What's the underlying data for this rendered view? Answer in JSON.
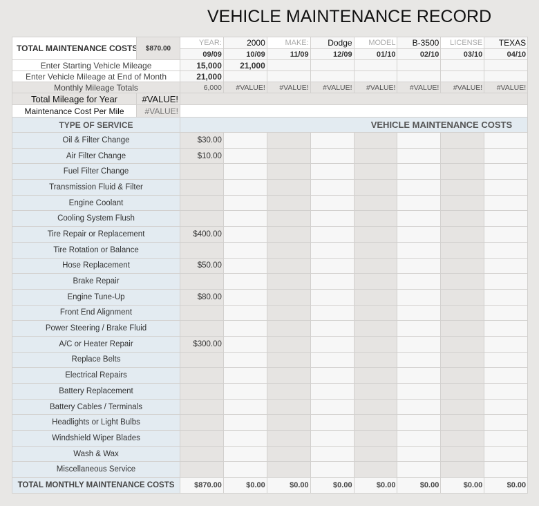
{
  "title": "VEHICLE MAINTENANCE RECORD",
  "header": {
    "total_label": "TOTAL MAINTENANCE COSTS",
    "total_value": "$870.00",
    "vehicle": [
      {
        "label": "YEAR:",
        "value": "2000"
      },
      {
        "label": "MAKE:",
        "value": "Dodge"
      },
      {
        "label": "MODEL",
        "value": "B-3500"
      },
      {
        "label": "LICENSE",
        "value": "TEXAS"
      }
    ],
    "months": [
      "09/09",
      "10/09",
      "11/09",
      "12/09",
      "01/10",
      "02/10",
      "03/10",
      "04/10"
    ]
  },
  "mileage": {
    "start_label": "Enter Starting Vehicle Mileage",
    "start": [
      "15,000",
      "21,000",
      "",
      "",
      "",
      "",
      "",
      ""
    ],
    "end_label": "Enter Vehicle Mileage at End of Month",
    "end": [
      "21,000",
      "",
      "",
      "",
      "",
      "",
      "",
      ""
    ],
    "monthly_label": "Monthly Mileage Totals",
    "monthly": [
      "6,000",
      "#VALUE!",
      "#VALUE!",
      "#VALUE!",
      "#VALUE!",
      "#VALUE!",
      "#VALUE!",
      "#VALUE!"
    ],
    "year_label": "Total Mileage for Year",
    "year_value": "#VALUE!",
    "cpm_label": "Maintenance Cost Per Mile",
    "cpm_value": "#VALUE!"
  },
  "services_header": "TYPE OF SERVICE",
  "costs_header": "VEHICLE MAINTENANCE COSTS",
  "services": [
    {
      "name": "Oil & Filter Change",
      "c": "$30.00"
    },
    {
      "name": "Air Filter Change",
      "c": "$10.00"
    },
    {
      "name": "Fuel Filter Change",
      "c": ""
    },
    {
      "name": "Transmission Fluid & Filter",
      "c": ""
    },
    {
      "name": "Engine Coolant",
      "c": ""
    },
    {
      "name": "Cooling System Flush",
      "c": ""
    },
    {
      "name": "Tire Repair or Replacement",
      "c": "$400.00"
    },
    {
      "name": "Tire Rotation or Balance",
      "c": ""
    },
    {
      "name": "Hose Replacement",
      "c": "$50.00"
    },
    {
      "name": "Brake Repair",
      "c": ""
    },
    {
      "name": "Engine Tune-Up",
      "c": "$80.00"
    },
    {
      "name": "Front End Alignment",
      "c": ""
    },
    {
      "name": "Power Steering / Brake Fluid",
      "c": ""
    },
    {
      "name": "A/C or Heater Repair",
      "c": "$300.00"
    },
    {
      "name": "Replace Belts",
      "c": ""
    },
    {
      "name": "Electrical Repairs",
      "c": ""
    },
    {
      "name": "Battery Replacement",
      "c": ""
    },
    {
      "name": "Battery Cables / Terminals",
      "c": ""
    },
    {
      "name": "Headlights or Light Bulbs",
      "c": ""
    },
    {
      "name": "Windshield Wiper Blades",
      "c": ""
    },
    {
      "name": "Wash & Wax",
      "c": ""
    },
    {
      "name": "Miscellaneous Service",
      "c": ""
    }
  ],
  "totals_label": "TOTAL MONTHLY MAINTENANCE COSTS",
  "totals": [
    "$870.00",
    "$0.00",
    "$0.00",
    "$0.00",
    "$0.00",
    "$0.00",
    "$0.00",
    "$0.00"
  ]
}
